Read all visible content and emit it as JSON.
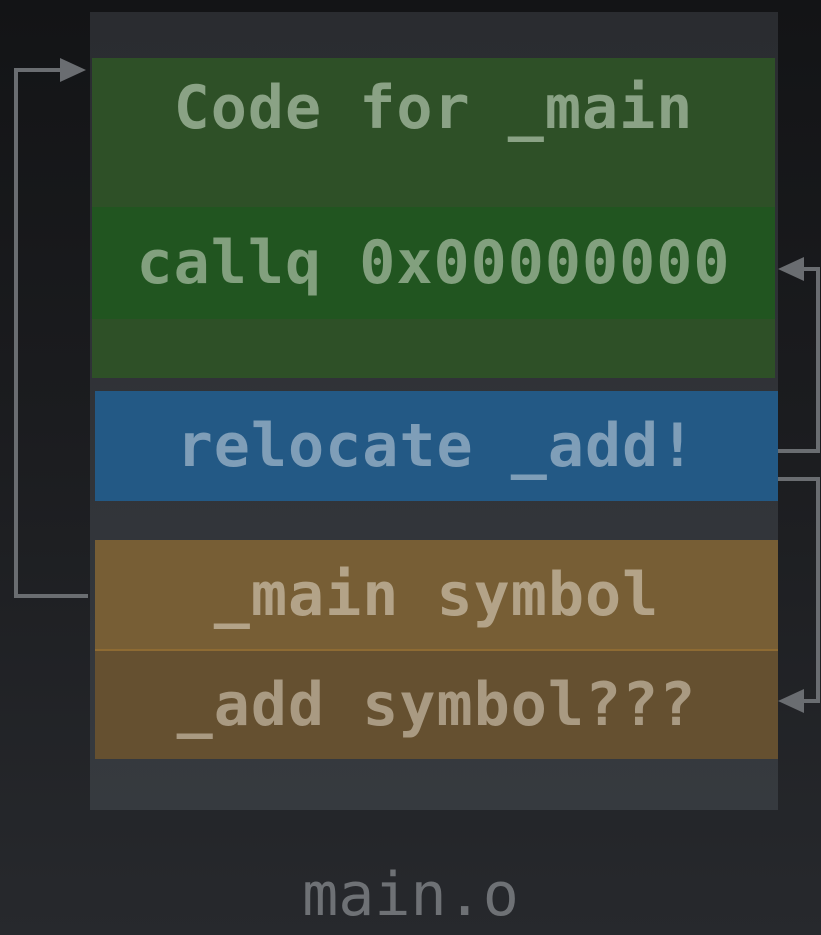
{
  "diagram": {
    "code_title": "Code for _main",
    "call_instruction": "callq 0x00000000",
    "relocation": "relocate _add!",
    "main_symbol": "_main symbol",
    "add_symbol": "_add symbol???",
    "file_label": "main.o"
  },
  "colors": {
    "background": "#1b1c1f",
    "code_section": "#2e5027",
    "call_row": "#215520",
    "relocation": "#235985",
    "main_symbol": "#775e35",
    "add_symbol": "#655030",
    "arrows": "#6a6d71"
  }
}
